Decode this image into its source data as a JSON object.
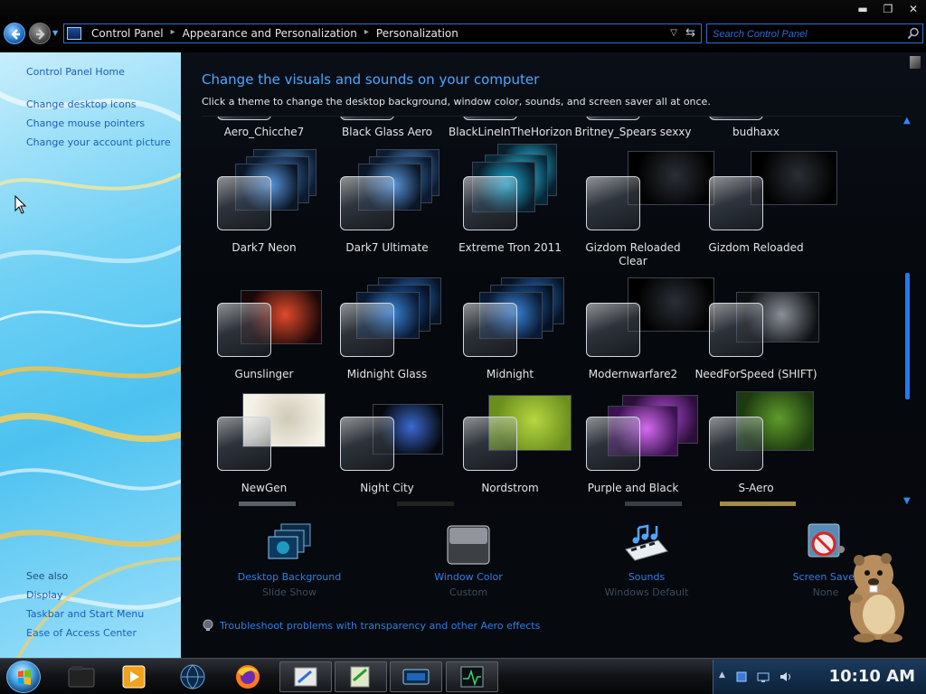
{
  "window": {
    "buttons": {
      "minimize": "▬",
      "maximize": "❐",
      "close": "✕"
    }
  },
  "address": {
    "breadcrumbs": [
      "Control Panel",
      "Appearance and Personalization",
      "Personalization"
    ],
    "search_placeholder": "Search Control Panel"
  },
  "sidebar": {
    "home": "Control Panel Home",
    "links": [
      "Change desktop icons",
      "Change mouse pointers",
      "Change your account picture"
    ],
    "see_also": "See also",
    "see_also_links": [
      "Display",
      "Taskbar and Start Menu",
      "Ease of Access Center"
    ]
  },
  "main": {
    "title": "Change the visuals and sounds on your computer",
    "subtitle": "Click a theme to change the desktop background, window color, sounds, and screen saver all at once.",
    "themes": [
      {
        "name": "Aero_Chicche7",
        "style": "partial"
      },
      {
        "name": "Black Glass Aero",
        "style": "partial"
      },
      {
        "name": "BlackLineInTheHorizon",
        "style": "partial"
      },
      {
        "name": "Britney_Spears sexxy",
        "style": "partial"
      },
      {
        "name": "budhaxx",
        "style": "partial"
      },
      {
        "name": "Dark7 Neon",
        "style": "stack-blue"
      },
      {
        "name": "Dark7 Ultimate",
        "style": "stack-blue"
      },
      {
        "name": "Extreme Tron 2011",
        "style": "stack-tron"
      },
      {
        "name": "Gizdom Reloaded Clear",
        "style": "black"
      },
      {
        "name": "Gizdom Reloaded",
        "style": "black"
      },
      {
        "name": "Gunslinger",
        "style": "equalizer"
      },
      {
        "name": "Midnight Glass",
        "style": "stack-midnight"
      },
      {
        "name": "Midnight",
        "style": "stack-midnight"
      },
      {
        "name": "Modernwarfare2",
        "style": "black"
      },
      {
        "name": "NeedForSpeed (SHIFT)",
        "style": "car"
      },
      {
        "name": "NewGen",
        "style": "white"
      },
      {
        "name": "Night City",
        "style": "nightcity"
      },
      {
        "name": "Nordstrom",
        "style": "grass"
      },
      {
        "name": "Purple and Black",
        "style": "purple"
      },
      {
        "name": "S-Aero",
        "style": "leaf"
      }
    ]
  },
  "options": [
    {
      "label": "Desktop Background",
      "sub": "Slide Show"
    },
    {
      "label": "Window Color",
      "sub": "Custom"
    },
    {
      "label": "Sounds",
      "sub": "Windows Default"
    },
    {
      "label": "Screen Saver",
      "sub": "None"
    }
  ],
  "troubleshoot": "Troubleshoot problems with transparency and other Aero effects",
  "taskbar": {
    "clock": "10:10 AM"
  },
  "colors": {
    "accent": "#2d7fe6",
    "title": "#4aa8ff",
    "sidebar_link": "#1a5fb8",
    "scroll_thumb": "#1e7cf6"
  }
}
